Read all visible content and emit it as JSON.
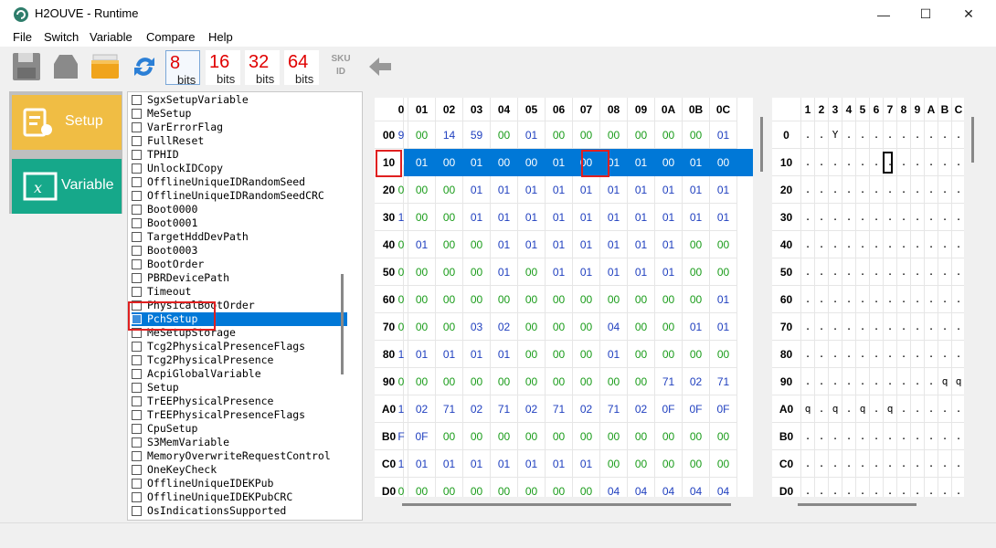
{
  "window": {
    "title": "H2OUVE - Runtime",
    "minimize": "—",
    "maximize": "☐",
    "close": "✕"
  },
  "menu": [
    "File",
    "Switch",
    "Variable",
    "Compare",
    "Help"
  ],
  "toolbar": {
    "bits": [
      {
        "n": "8",
        "label": "bits"
      },
      {
        "n": "16",
        "label": "bits"
      },
      {
        "n": "32",
        "label": "bits"
      },
      {
        "n": "64",
        "label": "bits"
      }
    ],
    "sku": "SKU",
    "id": "ID"
  },
  "nav": {
    "setup": "Setup",
    "variable": "Variable",
    "colors": {
      "setup": "#f0bd44",
      "variable": "#16a88a"
    }
  },
  "variables": [
    "SgxSetupVariable",
    "MeSetup",
    "VarErrorFlag",
    "FullReset",
    "TPHID",
    "UnlockIDCopy",
    "OfflineUniqueIDRandomSeed",
    "OfflineUniqueIDRandomSeedCRC",
    "Boot0000",
    "Boot0001",
    "TargetHddDevPath",
    "Boot0003",
    "BootOrder",
    "PBRDevicePath",
    "Timeout",
    "PhysicalBootOrder",
    "PchSetup",
    "MeSetupStorage",
    "Tcg2PhysicalPresenceFlags",
    "Tcg2PhysicalPresence",
    "AcpiGlobalVariable",
    "Setup",
    "TrEEPhysicalPresence",
    "TrEEPhysicalPresenceFlags",
    "CpuSetup",
    "S3MemVariable",
    "MemoryOverwriteRequestControl",
    "OneKeyCheck",
    "OfflineUniqueIDEKPub",
    "OfflineUniqueIDEKPubCRC",
    "OsIndicationsSupported"
  ],
  "selected_variable": "PchSetup",
  "hex": {
    "cols": [
      "0",
      "01",
      "02",
      "03",
      "04",
      "05",
      "06",
      "07",
      "08",
      "09",
      "0A",
      "0B",
      "0C"
    ],
    "rows": [
      {
        "addr": "00",
        "cells": [
          "9",
          "00",
          "14",
          "59",
          "00",
          "01",
          "00",
          "00",
          "00",
          "00",
          "00",
          "00",
          "01"
        ]
      },
      {
        "addr": "10",
        "cells": [
          "0",
          "01",
          "00",
          "01",
          "00",
          "00",
          "01",
          "00",
          "01",
          "01",
          "00",
          "01",
          "00"
        ]
      },
      {
        "addr": "20",
        "cells": [
          "0",
          "00",
          "00",
          "01",
          "01",
          "01",
          "01",
          "01",
          "01",
          "01",
          "01",
          "01",
          "01"
        ]
      },
      {
        "addr": "30",
        "cells": [
          "1",
          "00",
          "00",
          "01",
          "01",
          "01",
          "01",
          "01",
          "01",
          "01",
          "01",
          "01",
          "01"
        ]
      },
      {
        "addr": "40",
        "cells": [
          "0",
          "01",
          "00",
          "00",
          "01",
          "01",
          "01",
          "01",
          "01",
          "01",
          "01",
          "00",
          "00"
        ]
      },
      {
        "addr": "50",
        "cells": [
          "0",
          "00",
          "00",
          "00",
          "01",
          "00",
          "01",
          "01",
          "01",
          "01",
          "01",
          "00",
          "00"
        ]
      },
      {
        "addr": "60",
        "cells": [
          "0",
          "00",
          "00",
          "00",
          "00",
          "00",
          "00",
          "00",
          "00",
          "00",
          "00",
          "00",
          "01"
        ]
      },
      {
        "addr": "70",
        "cells": [
          "0",
          "00",
          "00",
          "03",
          "02",
          "00",
          "00",
          "00",
          "04",
          "00",
          "00",
          "01",
          "01"
        ]
      },
      {
        "addr": "80",
        "cells": [
          "1",
          "01",
          "01",
          "01",
          "01",
          "00",
          "00",
          "00",
          "01",
          "00",
          "00",
          "00",
          "00"
        ]
      },
      {
        "addr": "90",
        "cells": [
          "0",
          "00",
          "00",
          "00",
          "00",
          "00",
          "00",
          "00",
          "00",
          "00",
          "71",
          "02",
          "71"
        ]
      },
      {
        "addr": "A0",
        "cells": [
          "1",
          "02",
          "71",
          "02",
          "71",
          "02",
          "71",
          "02",
          "71",
          "02",
          "0F",
          "0F",
          "0F"
        ]
      },
      {
        "addr": "B0",
        "cells": [
          "F",
          "0F",
          "00",
          "00",
          "00",
          "00",
          "00",
          "00",
          "00",
          "00",
          "00",
          "00",
          "00"
        ]
      },
      {
        "addr": "C0",
        "cells": [
          "1",
          "01",
          "01",
          "01",
          "01",
          "01",
          "01",
          "01",
          "00",
          "00",
          "00",
          "00",
          "00"
        ]
      },
      {
        "addr": "D0",
        "cells": [
          "0",
          "00",
          "00",
          "00",
          "00",
          "00",
          "00",
          "00",
          "04",
          "04",
          "04",
          "04",
          "04"
        ]
      }
    ]
  },
  "ascii": {
    "cols": [
      "1",
      "2",
      "3",
      "4",
      "5",
      "6",
      "7",
      "8",
      "9",
      "A",
      "B",
      "C"
    ],
    "rows": [
      {
        "addr": "0",
        "cells": [
          ".",
          ".",
          "Y",
          ".",
          ".",
          ".",
          ".",
          ".",
          ".",
          ".",
          ".",
          "."
        ]
      },
      {
        "addr": "10",
        "cells": [
          ".",
          ".",
          ".",
          ".",
          ".",
          ".",
          ".",
          ".",
          ".",
          ".",
          ".",
          "."
        ]
      },
      {
        "addr": "20",
        "cells": [
          ".",
          ".",
          ".",
          ".",
          ".",
          ".",
          ".",
          ".",
          ".",
          ".",
          ".",
          "."
        ]
      },
      {
        "addr": "30",
        "cells": [
          ".",
          ".",
          ".",
          ".",
          ".",
          ".",
          ".",
          ".",
          ".",
          ".",
          ".",
          "."
        ]
      },
      {
        "addr": "40",
        "cells": [
          ".",
          ".",
          ".",
          ".",
          ".",
          ".",
          ".",
          ".",
          ".",
          ".",
          ".",
          "."
        ]
      },
      {
        "addr": "50",
        "cells": [
          ".",
          ".",
          ".",
          ".",
          ".",
          ".",
          ".",
          ".",
          ".",
          ".",
          ".",
          "."
        ]
      },
      {
        "addr": "60",
        "cells": [
          ".",
          ".",
          ".",
          ".",
          ".",
          ".",
          ".",
          ".",
          ".",
          ".",
          ".",
          "."
        ]
      },
      {
        "addr": "70",
        "cells": [
          ".",
          ".",
          ".",
          ".",
          ".",
          ".",
          ".",
          ".",
          ".",
          ".",
          ".",
          "."
        ]
      },
      {
        "addr": "80",
        "cells": [
          ".",
          ".",
          ".",
          ".",
          ".",
          ".",
          ".",
          ".",
          ".",
          ".",
          ".",
          "."
        ]
      },
      {
        "addr": "90",
        "cells": [
          ".",
          ".",
          ".",
          ".",
          ".",
          ".",
          ".",
          ".",
          ".",
          ".",
          "q",
          "q"
        ]
      },
      {
        "addr": "A0",
        "cells": [
          "q",
          ".",
          "q",
          ".",
          "q",
          ".",
          "q",
          ".",
          ".",
          ".",
          ".",
          "."
        ]
      },
      {
        "addr": "B0",
        "cells": [
          ".",
          ".",
          ".",
          ".",
          ".",
          ".",
          ".",
          ".",
          ".",
          ".",
          ".",
          "."
        ]
      },
      {
        "addr": "C0",
        "cells": [
          ".",
          ".",
          ".",
          ".",
          ".",
          ".",
          ".",
          ".",
          ".",
          ".",
          ".",
          "."
        ]
      },
      {
        "addr": "D0",
        "cells": [
          ".",
          ".",
          ".",
          ".",
          ".",
          ".",
          ".",
          ".",
          ".",
          ".",
          ".",
          "."
        ]
      }
    ]
  }
}
